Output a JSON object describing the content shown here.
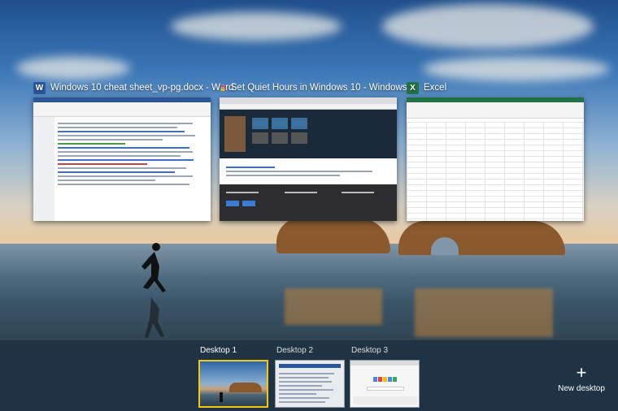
{
  "windows": [
    {
      "title": "Windows 10 cheat sheet_vp-pg.docx - Word",
      "icon": "word-icon",
      "icon_letter": "W",
      "icon_color": "#2b579a"
    },
    {
      "title": "Set Quiet Hours in Windows 10 - Windows...",
      "icon": "chrome-icon",
      "icon_letter": "",
      "icon_color": "#db4437"
    },
    {
      "title": "Excel",
      "icon": "excel-icon",
      "icon_letter": "X",
      "icon_color": "#217346"
    }
  ],
  "desktops": [
    {
      "label": "Desktop 1",
      "active": true
    },
    {
      "label": "Desktop 2",
      "active": false
    },
    {
      "label": "Desktop 3",
      "active": false
    }
  ],
  "new_desktop": {
    "icon": "plus-icon",
    "label": "New desktop"
  },
  "colors": {
    "active_border": "#f2c811",
    "bar_bg": "#1e2830"
  }
}
